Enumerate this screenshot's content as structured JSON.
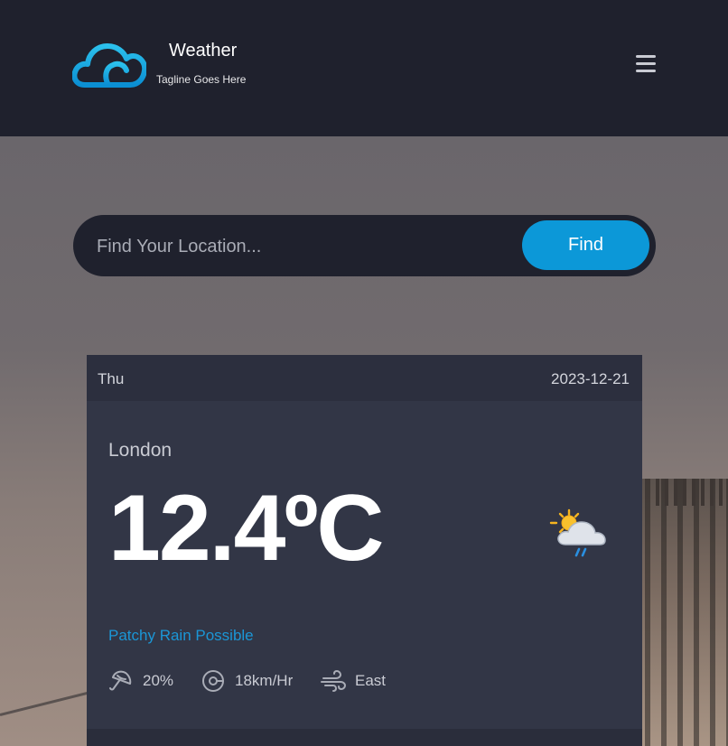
{
  "header": {
    "title": "Weather",
    "tagline": "Tagline Goes Here",
    "logo_icon": "cloud-icon",
    "menu_icon": "hamburger-menu-icon"
  },
  "search": {
    "placeholder": "Find Your Location...",
    "value": "",
    "button_label": "Find"
  },
  "forecast": {
    "day": "Thu",
    "date": "2023-12-21",
    "city": "London",
    "temperature": "12.4ºC",
    "condition": "Patchy Rain Possible",
    "condition_icon": "sun-cloud-rain-icon",
    "stats": {
      "rain_chance": "20%",
      "wind_speed": "18km/Hr",
      "wind_direction": "East"
    }
  },
  "colors": {
    "header_bg": "#1f212d",
    "accent": "#0c98d8",
    "card_bg": "#323646",
    "condition_text": "#1b96d6"
  }
}
